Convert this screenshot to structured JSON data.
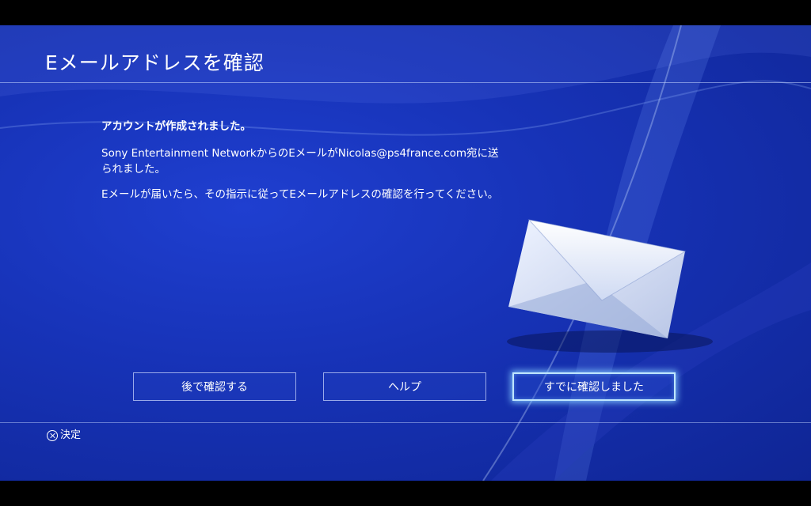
{
  "screen": {
    "title": "Eメールアドレスを確認"
  },
  "message": {
    "heading": "アカウントが作成されました。",
    "line1": "Sony Entertainment NetworkからのEメールがNicolas@ps4france.com宛に送られました。",
    "line2": "Eメールが届いたら、その指示に従ってEメールアドレスの確認を行ってください。"
  },
  "buttons": {
    "later": "後で確認する",
    "help": "ヘルプ",
    "confirmed": "すでに確認しました"
  },
  "footer": {
    "icon": "cross-button-icon",
    "hint": "決定"
  },
  "colors": {
    "background": "#1733b8",
    "focus_glow": "#bfe6ff",
    "text": "#ffffff"
  }
}
